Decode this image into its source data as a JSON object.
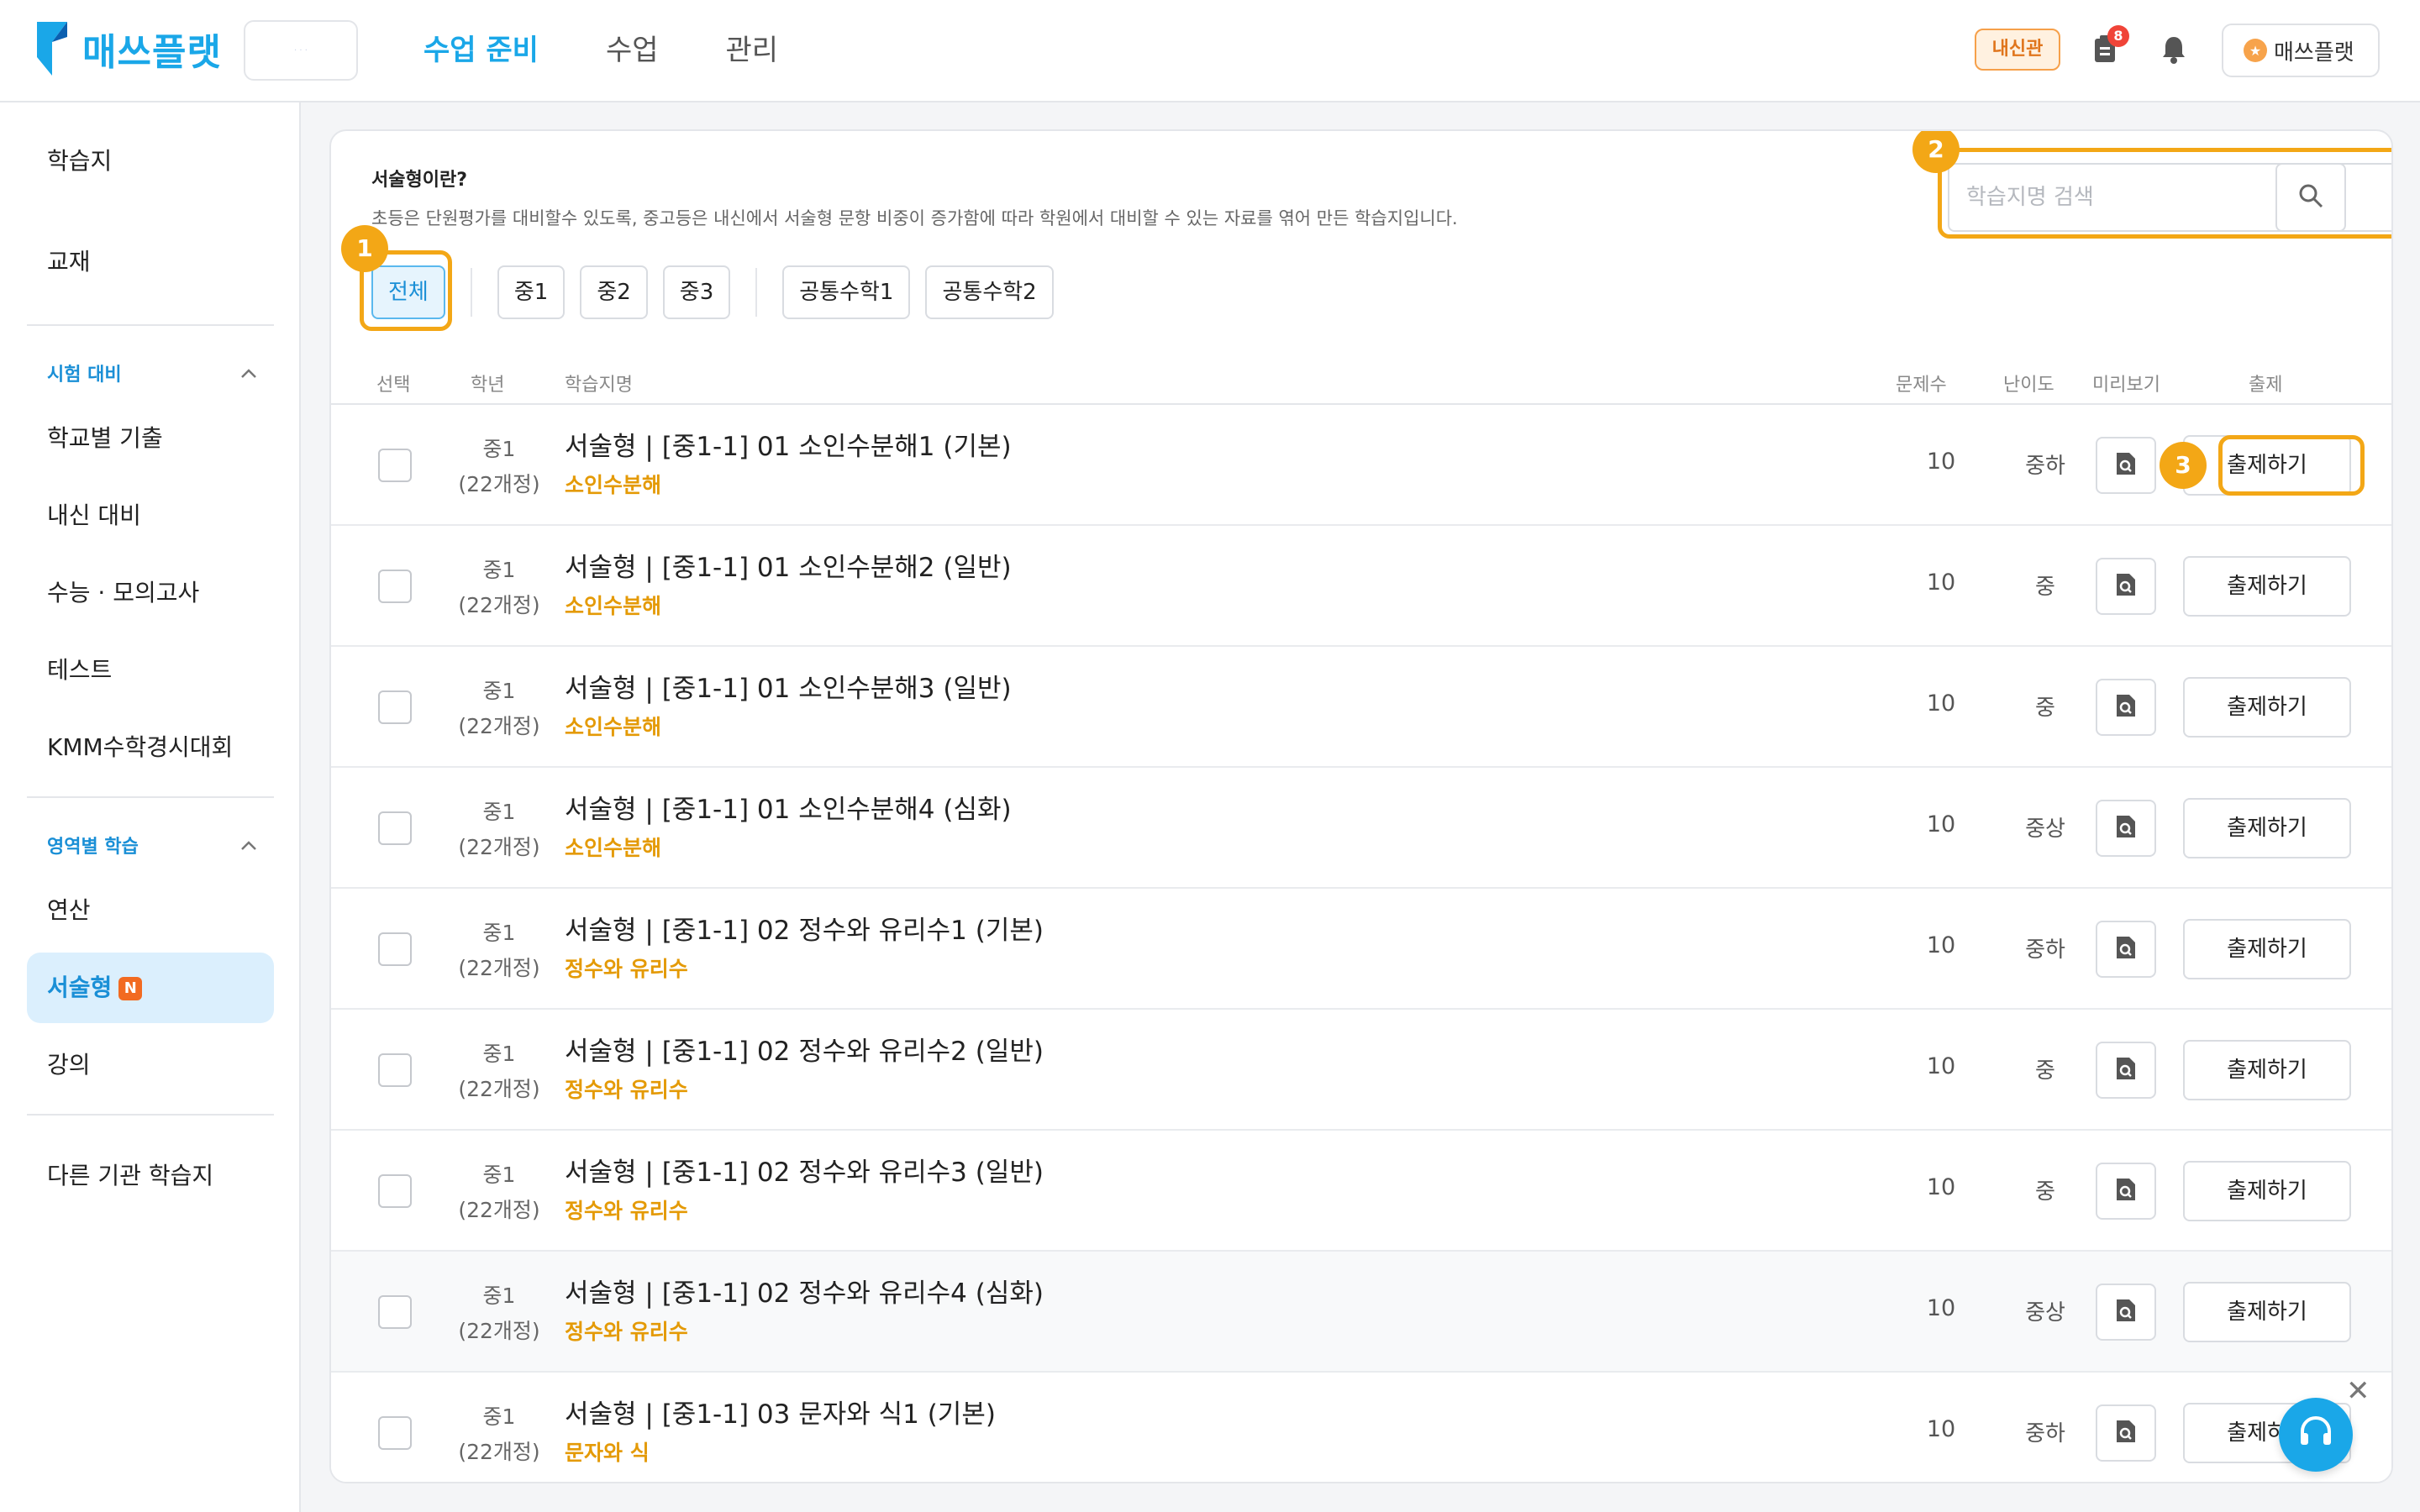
{
  "brand": {
    "name": "매쓰플랫",
    "partner_logo_text": "· · ·",
    "color": "#1aa7e8"
  },
  "nav": {
    "items": [
      {
        "label": "수업 준비",
        "active": true
      },
      {
        "label": "수업",
        "active": false
      },
      {
        "label": "관리",
        "active": false
      }
    ]
  },
  "header": {
    "naesin_badge": "내신관",
    "notification_count": "8",
    "user_label": "매쓰플랫",
    "user_icon": "★"
  },
  "sidebar": {
    "top_items": [
      "학습지",
      "교재"
    ],
    "group1": {
      "label": "시험 대비",
      "items": [
        "학교별 기출",
        "내신 대비",
        "수능 · 모의고사",
        "테스트",
        "KMM수학경시대회"
      ]
    },
    "group2": {
      "label": "영역별 학습",
      "items": [
        "연산",
        "서술형",
        "강의"
      ],
      "active": "서술형",
      "new_badge": "N"
    },
    "bottom_items": [
      "다른 기관 학습지"
    ]
  },
  "intro": {
    "title": "서술형이란?",
    "desc": "초등은 단원평가를 대비할수 있도록, 중고등은 내신에서 서술형 문항 비중이 증가함에 따라 학원에서 대비할 수 있는 자료를 엮어 만든 학습지입니다."
  },
  "filters": {
    "all": "전체",
    "grades": [
      "중1",
      "중2",
      "중3"
    ],
    "common": [
      "공통수학1",
      "공통수학2"
    ]
  },
  "search": {
    "placeholder": "학습지명 검색"
  },
  "table": {
    "headers": {
      "select": "선택",
      "grade": "학년",
      "name": "학습지명",
      "count": "문제수",
      "level": "난이도",
      "preview": "미리보기",
      "assign": "출제"
    },
    "rows": [
      {
        "grade": "중1",
        "curriculum": "(22개정)",
        "title": "서술형 | [중1-1] 01 소인수분해1 (기본)",
        "topic": "소인수분해",
        "count": "10",
        "level": "중하",
        "assign": "출제하기"
      },
      {
        "grade": "중1",
        "curriculum": "(22개정)",
        "title": "서술형 | [중1-1] 01 소인수분해2 (일반)",
        "topic": "소인수분해",
        "count": "10",
        "level": "중",
        "assign": "출제하기"
      },
      {
        "grade": "중1",
        "curriculum": "(22개정)",
        "title": "서술형 | [중1-1] 01 소인수분해3 (일반)",
        "topic": "소인수분해",
        "count": "10",
        "level": "중",
        "assign": "출제하기"
      },
      {
        "grade": "중1",
        "curriculum": "(22개정)",
        "title": "서술형 | [중1-1] 01 소인수분해4 (심화)",
        "topic": "소인수분해",
        "count": "10",
        "level": "중상",
        "assign": "출제하기"
      },
      {
        "grade": "중1",
        "curriculum": "(22개정)",
        "title": "서술형 | [중1-1] 02 정수와 유리수1 (기본)",
        "topic": "정수와 유리수",
        "count": "10",
        "level": "중하",
        "assign": "출제하기"
      },
      {
        "grade": "중1",
        "curriculum": "(22개정)",
        "title": "서술형 | [중1-1] 02 정수와 유리수2 (일반)",
        "topic": "정수와 유리수",
        "count": "10",
        "level": "중",
        "assign": "출제하기"
      },
      {
        "grade": "중1",
        "curriculum": "(22개정)",
        "title": "서술형 | [중1-1] 02 정수와 유리수3 (일반)",
        "topic": "정수와 유리수",
        "count": "10",
        "level": "중",
        "assign": "출제하기"
      },
      {
        "grade": "중1",
        "curriculum": "(22개정)",
        "title": "서술형 | [중1-1] 02 정수와 유리수4 (심화)",
        "topic": "정수와 유리수",
        "count": "10",
        "level": "중상",
        "assign": "출제하기"
      },
      {
        "grade": "중1",
        "curriculum": "(22개정)",
        "title": "서술형 | [중1-1] 03 문자와 식1 (기본)",
        "topic": "문자와 식",
        "count": "10",
        "level": "중하",
        "assign": "출제하기"
      }
    ]
  },
  "callouts": [
    "1",
    "2",
    "3"
  ],
  "colors": {
    "accent": "#1aa7e8",
    "callout": "#f3a716",
    "topic": "#e49a06",
    "new_badge": "#f26a21"
  },
  "icons": [
    "search-icon",
    "bell-icon",
    "document-icon",
    "chevron-up-icon",
    "preview-icon",
    "headset-icon",
    "close-icon"
  ]
}
